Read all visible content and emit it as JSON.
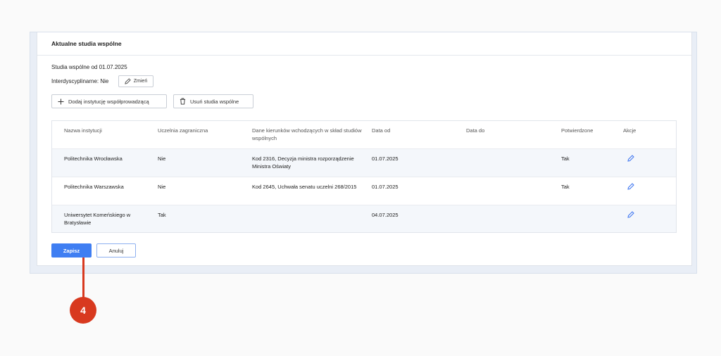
{
  "section": {
    "title": "Aktualne studia wspólne"
  },
  "info": {
    "since_label": "Studia wspólne od 01.07.2025",
    "interdisciplinary_label": "Interdyscyplinarne: Nie",
    "change_button": "Zmień"
  },
  "actions": {
    "add_institution": "Dodaj instytucję współprowadzącą",
    "remove_studies": "Usuń studia wspólne"
  },
  "table": {
    "headers": [
      "Nazwa instytucji",
      "Uczelnia zagraniczna",
      "Dane kierunków wchodzących w skład studiów wspólnych",
      "Data od",
      "Data do",
      "Potwierdzone",
      "Akcje"
    ],
    "rows": [
      [
        "Politechnika Wrocławska",
        "Nie",
        "Kod 2316, Decyzja ministra rozporządzenie Ministra Oświaty",
        "01.07.2025",
        "",
        "Tak"
      ],
      [
        "Politechnika Warszawska",
        "Nie",
        "Kod 2645, Uchwała senatu uczelni 268/2015",
        "01.07.2025",
        "",
        "Tak"
      ],
      [
        "Uniwersytet Komeńskiego w Bratysławie",
        "Tak",
        "",
        "04.07.2025",
        "",
        ""
      ]
    ]
  },
  "footer": {
    "save": "Zapisz",
    "cancel": "Anuluj"
  },
  "callout": {
    "number": "4"
  },
  "colors": {
    "accent": "#3f7ef2",
    "callout": "#d8391f",
    "row_alt": "#f4f7fb"
  }
}
